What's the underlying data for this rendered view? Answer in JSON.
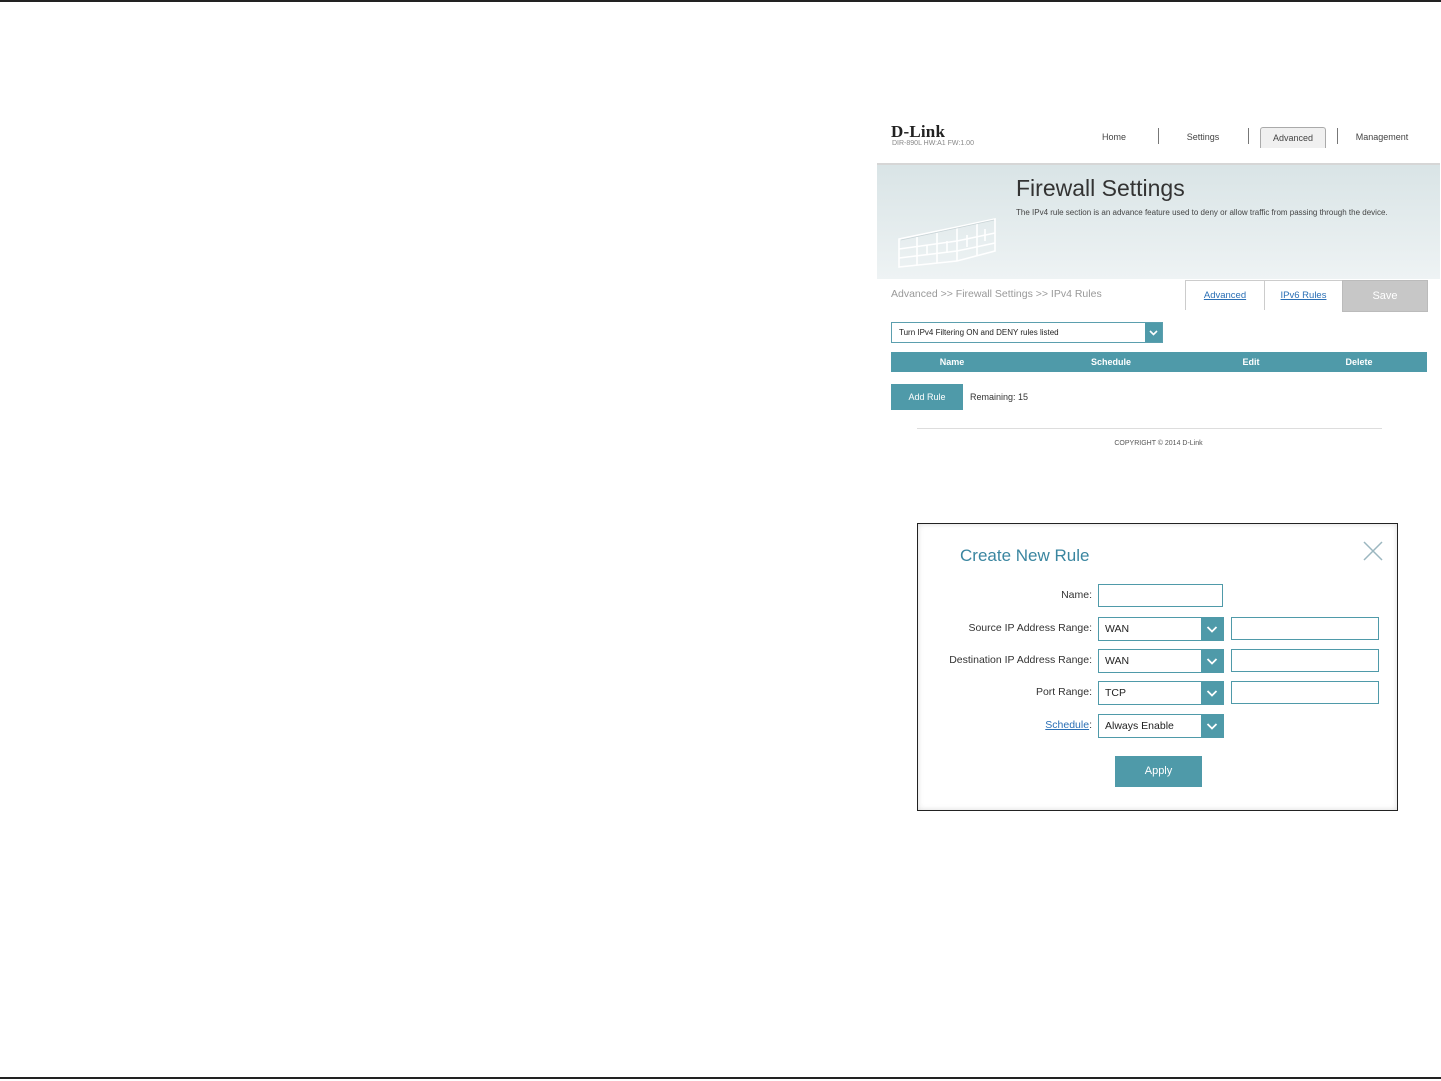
{
  "router_page": {
    "brand": "D-Link",
    "model_info": "DIR-890L  HW:A1  FW:1.00",
    "nav": [
      "Home",
      "Settings",
      "Advanced",
      "Management"
    ],
    "active_nav": "Advanced",
    "banner": {
      "title": "Firewall Settings",
      "description": "The IPv4 rule section is an advance feature used to deny or allow traffic from passing through the device."
    },
    "breadcrumb": "Advanced >> Firewall Settings >> IPv4 Rules",
    "tabs": [
      "Advanced",
      "IPv6 Rules"
    ],
    "save_label": "Save",
    "filter_value": "Turn IPv4 Filtering ON and DENY rules listed",
    "table_headers": [
      "Name",
      "Schedule",
      "Edit",
      "Delete"
    ],
    "add_rule_label": "Add Rule",
    "remaining_text": "Remaining: 15",
    "copyright": "COPYRIGHT © 2014 D-Link"
  },
  "dialog": {
    "title": "Create New Rule",
    "name_label": "Name:",
    "source_label": "Source IP Address Range:",
    "source_value": "WAN",
    "destination_label": "Destination IP Address Range:",
    "destination_value": "WAN",
    "port_label": "Port Range:",
    "port_value": "TCP",
    "schedule_label": "Schedule",
    "schedule_colon": ":",
    "schedule_value": "Always Enable",
    "apply_label": "Apply"
  },
  "colors": {
    "accent": "#4f9aa9",
    "link": "#2a6fb5",
    "title_teal": "#3a86a0"
  }
}
